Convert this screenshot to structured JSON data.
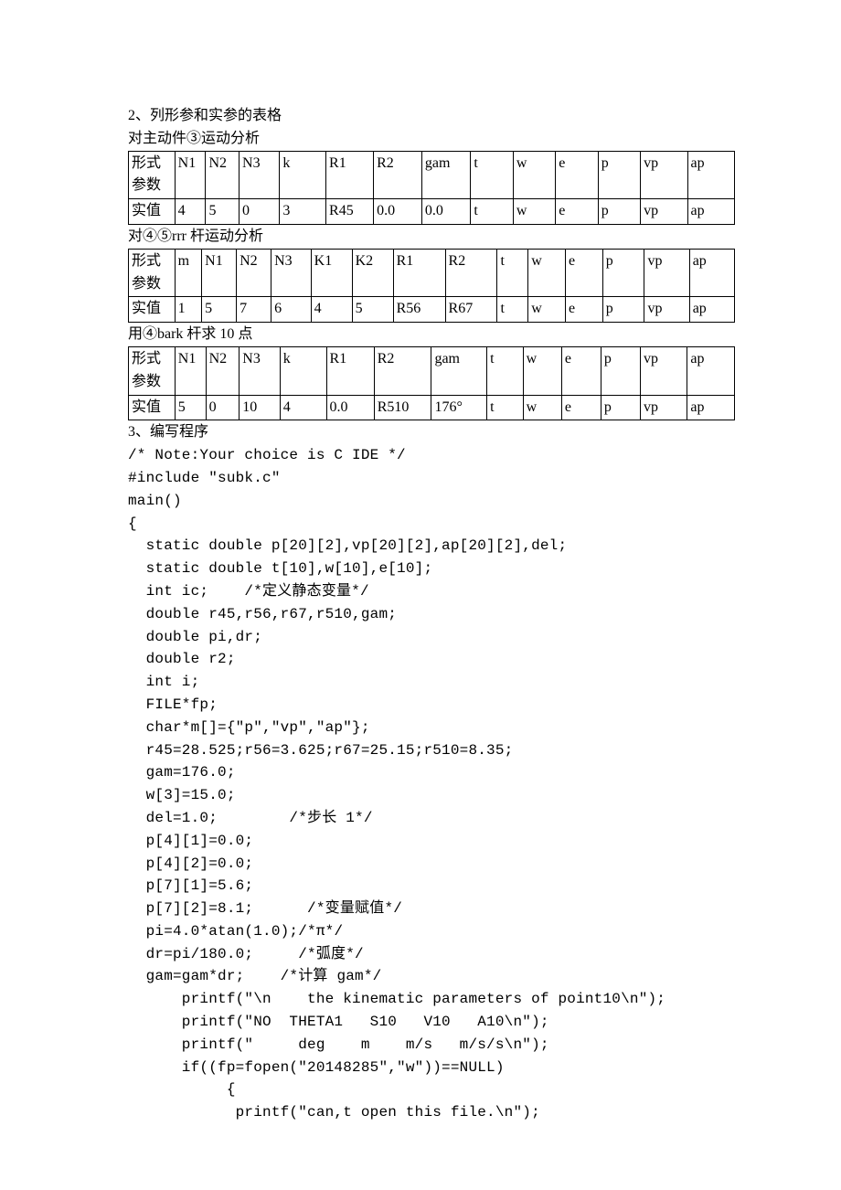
{
  "sec2_title": "2、列形参和实参的表格",
  "table1_caption": "对主动件③运动分析",
  "table1": {
    "r0": [
      "形式参数",
      "N1",
      "N2",
      "N3",
      "k",
      "R1",
      "R2",
      "gam",
      "t",
      "w",
      "e",
      "p",
      "vp",
      "ap"
    ],
    "r1": [
      "实值",
      "4",
      "5",
      "0",
      "3",
      "R45",
      "0.0",
      "0.0",
      "t",
      "w",
      "e",
      "p",
      "vp",
      "ap"
    ]
  },
  "table2_caption": "对④⑤rrr 杆运动分析",
  "table2": {
    "r0": [
      "形式参数",
      "m",
      "N1",
      "N2",
      "N3",
      "K1",
      "K2",
      "R1",
      "R2",
      "t",
      "w",
      "e",
      "p",
      "vp",
      "ap"
    ],
    "r1": [
      "实值",
      "1",
      "5",
      "7",
      "6",
      "4",
      "5",
      "R56",
      "R67",
      "t",
      "w",
      "e",
      "p",
      "vp",
      "ap"
    ]
  },
  "table3_caption": "用④bark 杆求 10 点",
  "table3": {
    "r0": [
      "形式参数",
      "N1",
      "N2",
      "N3",
      "k",
      "R1",
      "R2",
      "gam",
      "t",
      "w",
      "e",
      "p",
      "vp",
      "ap"
    ],
    "r1": [
      "实值",
      "5",
      "0",
      "10",
      "4",
      "0.0",
      "R510",
      "176°",
      "t",
      "w",
      "e",
      "p",
      "vp",
      "ap"
    ]
  },
  "sec3_title": "3、编写程序",
  "code": {
    "l01": "/* Note:Your choice is C IDE */",
    "l02": "#include \"subk.c\"",
    "l03": "main()",
    "l04": "{",
    "l05": "  static double p[20][2],vp[20][2],ap[20][2],del;",
    "l06": "  static double t[10],w[10],e[10];",
    "l07a": "  int ic;    /*",
    "l07b": "定义静态变量",
    "l07c": "*/",
    "l08": "  double r45,r56,r67,r510,gam;",
    "l09": "  double pi,dr;",
    "l10": "  double r2;",
    "l11": "  int i;",
    "l12": "  FILE*fp;",
    "l13": "  char*m[]={\"p\",\"vp\",\"ap\"};",
    "l14": "  r45=28.525;r56=3.625;r67=25.15;r510=8.35;",
    "l15": "  gam=176.0;",
    "l16": "  w[3]=15.0;",
    "l17a": "  del=1.0;        /*",
    "l17b": "步长",
    "l17c": " 1*/",
    "l18": "  p[4][1]=0.0;",
    "l19": "  p[4][2]=0.0;",
    "l20": "  p[7][1]=5.6;",
    "l21a": "  p[7][2]=8.1;      /*",
    "l21b": "变量赋值",
    "l21c": "*/",
    "l22a": "  pi=4.0*atan(1.0);/*",
    "l22b": "π",
    "l22c": "*/",
    "l23a": "  dr=pi/180.0;     /*",
    "l23b": "弧度",
    "l23c": "*/",
    "l24a": "  gam=gam*dr;    /*",
    "l24b": "计算",
    "l24c": " gam*/",
    "l25": "      printf(\"\\n    the kinematic parameters of point10\\n\");",
    "l26": "      printf(\"NO  THETA1   S10   V10   A10\\n\");",
    "l27": "      printf(\"     deg    m    m/s   m/s/s\\n\");",
    "l28": "      if((fp=fopen(\"20148285\",\"w\"))==NULL)",
    "l29": "           {",
    "l30": "            printf(\"can,t open this file.\\n\");"
  }
}
